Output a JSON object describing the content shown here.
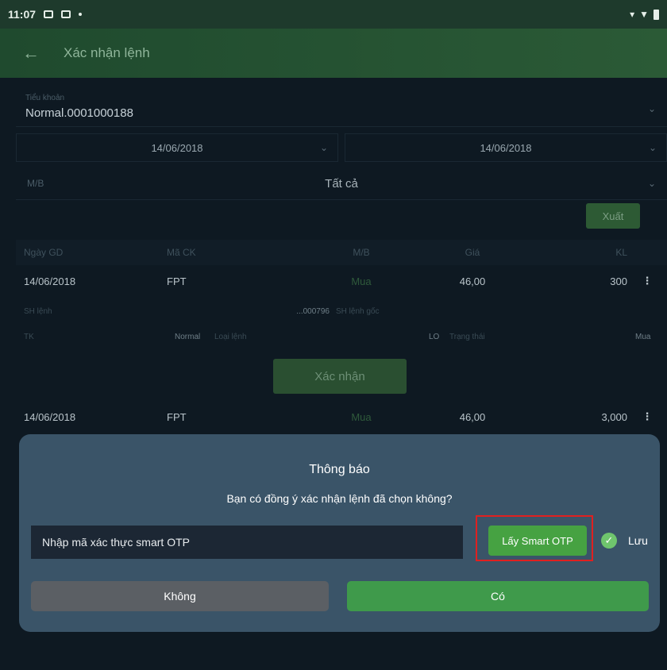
{
  "status_bar": {
    "time": "11:07"
  },
  "app_bar": {
    "back_glyph": "←",
    "title": "Xác nhận lệnh"
  },
  "account": {
    "label": "Tiểu khoản",
    "value": "Normal.0001000188"
  },
  "date_filter": {
    "from": "14/06/2018",
    "to": "14/06/2018"
  },
  "mb_filter": {
    "label": "M/B",
    "value": "Tất cả"
  },
  "export_button": "Xuất",
  "table": {
    "headers": [
      "Ngày GD",
      "Mã CK",
      "M/B",
      "Giá",
      "KL"
    ],
    "rows": [
      {
        "date": "14/06/2018",
        "symbol": "FPT",
        "side": "Mua",
        "price": "46,00",
        "qty": "300"
      },
      {
        "date": "14/06/2018",
        "symbol": "FPT",
        "side": "Mua",
        "price": "46,00",
        "qty": "3,000"
      }
    ],
    "detail1": {
      "label_a": "SH lệnh",
      "value_a": "...000796",
      "label_b": "SH lệnh gốc"
    },
    "detail2": {
      "label_a": "TK",
      "value_a": "Normal",
      "label_b": "Loại lệnh",
      "value_b": "LO",
      "label_c": "Trạng thái",
      "value_c": "Mua"
    }
  },
  "confirm_button": "Xác nhận",
  "dialog": {
    "title": "Thông báo",
    "message": "Bạn có đồng ý xác nhận lệnh đã chọn không?",
    "otp_placeholder": "Nhập mã xác thực smart OTP",
    "otp_button": "Lấy Smart OTP",
    "save_label": "Lưu",
    "no_button": "Không",
    "yes_button": "Có"
  },
  "colors": {
    "accent_green": "#46a242",
    "highlight_red": "#e02020",
    "dialog_bg": "#3a5468"
  }
}
